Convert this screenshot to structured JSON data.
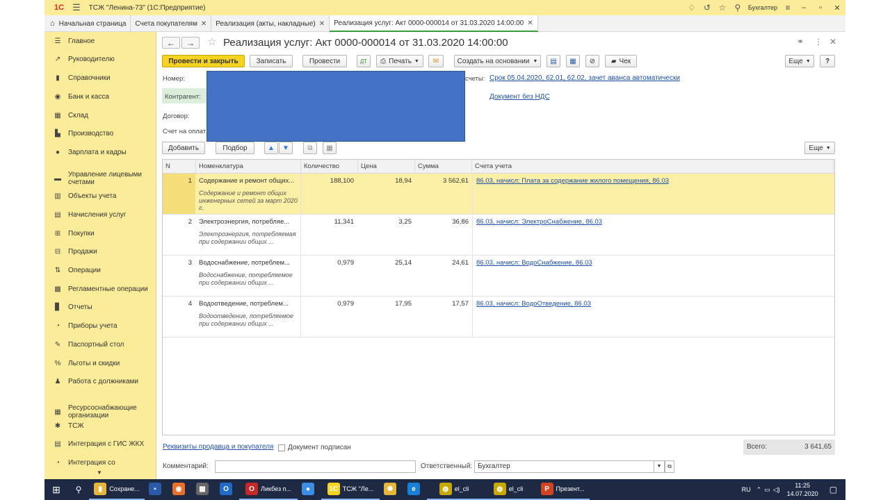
{
  "window": {
    "title": "ТСЖ \"Ленина-73\"  (1С:Предприятие)",
    "logo": "1С",
    "user": "Бухгалтер"
  },
  "tabs": [
    {
      "label": "Начальная страница",
      "closable": false,
      "active": false
    },
    {
      "label": "Счета покупателям",
      "closable": true,
      "active": false
    },
    {
      "label": "Реализация (акты, накладные)",
      "closable": true,
      "active": false
    },
    {
      "label": "Реализация услуг: Акт 0000-000014 от 31.03.2020 14:00:00",
      "closable": true,
      "active": true
    }
  ],
  "sidebar": {
    "items": [
      {
        "label": "Главное",
        "icon": "menu-icon",
        "glyph": "☰"
      },
      {
        "label": "Руководителю",
        "icon": "trend-icon",
        "glyph": "↗"
      },
      {
        "label": "Справочники",
        "icon": "book-icon",
        "glyph": "▮"
      },
      {
        "label": "Банк и касса",
        "icon": "coin-icon",
        "glyph": "◉"
      },
      {
        "label": "Склад",
        "icon": "warehouse-icon",
        "glyph": "▦"
      },
      {
        "label": "Производство",
        "icon": "factory-icon",
        "glyph": "▙"
      },
      {
        "label": "Зарплата и кадры",
        "icon": "person-icon",
        "glyph": "●"
      },
      {
        "label": "Управление лицевыми счетами",
        "icon": "accounts-icon",
        "glyph": "▬"
      },
      {
        "label": "Объекты учета",
        "icon": "building-icon",
        "glyph": "▥"
      },
      {
        "label": "Начисления услуг",
        "icon": "clipboard-icon",
        "glyph": "▤"
      },
      {
        "label": "Покупки",
        "icon": "cart-icon",
        "glyph": "⊞"
      },
      {
        "label": "Продажи",
        "icon": "basket-icon",
        "glyph": "⊟"
      },
      {
        "label": "Операции",
        "icon": "operations-icon",
        "glyph": "⇅"
      },
      {
        "label": "Регламентные операции",
        "icon": "schedule-icon",
        "glyph": "▩"
      },
      {
        "label": "Отчеты",
        "icon": "report-icon",
        "glyph": "▊"
      },
      {
        "label": "Приборы учета",
        "icon": "meter-icon",
        "glyph": "◔"
      },
      {
        "label": "Паспортный стол",
        "icon": "passport-icon",
        "glyph": "✎"
      },
      {
        "label": "Льготы и скидки",
        "icon": "percent-icon",
        "glyph": "%"
      },
      {
        "label": "Работа с должниками",
        "icon": "gavel-icon",
        "glyph": "♟"
      },
      {
        "label": "Ресурсоснабжающие организации",
        "icon": "resource-icon",
        "glyph": "▦"
      },
      {
        "label": "ТСЖ",
        "icon": "hoa-icon",
        "glyph": "✱"
      },
      {
        "label": "Интеграция с ГИС ЖКХ",
        "icon": "integration-icon",
        "glyph": "▤"
      },
      {
        "label": "Интеграция со",
        "icon": "integration2-icon",
        "glyph": "◔"
      }
    ]
  },
  "document": {
    "title": "Реализация услуг: Акт 0000-000014 от 31.03.2020 14:00:00",
    "toolbar": {
      "post_close": "Провести и закрыть",
      "save": "Записать",
      "post": "Провести",
      "print": "Печать",
      "create_based": "Создать на основании",
      "check": "Чек",
      "more": "Еще",
      "help": "?"
    },
    "fields": {
      "number_label": "Номер:",
      "counterparty_label": "Контрагент:",
      "contract_label": "Договор:",
      "invoice_label": "Счет на оплат",
      "accounts_label": "счеты:",
      "accounts_link": "Срок 05.04.2020, 62.01, 62.02, зачет аванса автоматически",
      "vat_link": "Документ без НДС"
    },
    "table_toolbar": {
      "add": "Добавить",
      "select": "Подбор",
      "more": "Еще"
    },
    "columns": [
      "N",
      "Номенклатура",
      "Количество",
      "Цена",
      "Сумма",
      "Счета учета"
    ],
    "rows": [
      {
        "n": "1",
        "item": "Содержание и ремонт общих...",
        "desc": "Содержание и ремонт общих инженерных сетей за март 2020 г.",
        "qty": "188,100",
        "price": "18,94",
        "sum": "3 562,61",
        "account": "86.03, начисл: Плата за содержание жилого помещения, 86.03"
      },
      {
        "n": "2",
        "item": "Электроэнергия, потребляе...",
        "desc": "Электроэнергия, потребляемая при содержании общих ...",
        "qty": "11,341",
        "price": "3,25",
        "sum": "36,86",
        "account": "86.03, начисл: ЭлектроСнабжение, 86.03"
      },
      {
        "n": "3",
        "item": "Водоснабжение, потреблем...",
        "desc": "Водоснабжение, потребляемое при содержании общих ...",
        "qty": "0,979",
        "price": "25,14",
        "sum": "24,61",
        "account": "86.03, начисл: ВодоСнабжение, 86.03"
      },
      {
        "n": "4",
        "item": "Водоотведение, потреблем...",
        "desc": "Водоотведение, потребляемое при содержании общих ...",
        "qty": "0,979",
        "price": "17,95",
        "sum": "17,57",
        "account": "86.03, начисл: ВодоОтведение, 86.03"
      }
    ],
    "footer": {
      "requisites_link": "Реквизиты продавца и покупателя",
      "signed_label": "Документ подписан",
      "total_label": "Всего:",
      "total_value": "3 641,65",
      "comment_label": "Комментарий:",
      "comment_value": "",
      "responsible_label": "Ответственный:",
      "responsible_value": "Бухгалтер"
    }
  },
  "taskbar": {
    "apps": [
      {
        "label": "Сохране...",
        "color": "#e8b53c",
        "glyph": "▮"
      },
      {
        "label": "",
        "color": "#2a5aa8",
        "glyph": "▪"
      },
      {
        "label": "",
        "color": "#e8702a",
        "glyph": "◉"
      },
      {
        "label": "",
        "color": "#666",
        "glyph": "▦"
      },
      {
        "label": "",
        "color": "#1e6cc8",
        "glyph": "O"
      },
      {
        "label": "Ликбез п...",
        "color": "#c62828",
        "glyph": "O"
      },
      {
        "label": "",
        "color": "#3a8ee6",
        "glyph": "●"
      },
      {
        "label": "ТСЖ \"Ле...",
        "color": "#f6d221",
        "glyph": "1С"
      },
      {
        "label": "",
        "color": "#e8b53c",
        "glyph": "✺"
      },
      {
        "label": "",
        "color": "#1a7fd6",
        "glyph": "e"
      },
      {
        "label": "el_cli",
        "color": "#c9a800",
        "glyph": "◍"
      },
      {
        "label": "el_cli",
        "color": "#c9a800",
        "glyph": "◍"
      },
      {
        "label": "Презент...",
        "color": "#d04423",
        "glyph": "P"
      }
    ],
    "lang": "RU",
    "time": "11:25",
    "date": "14.07.2020"
  }
}
